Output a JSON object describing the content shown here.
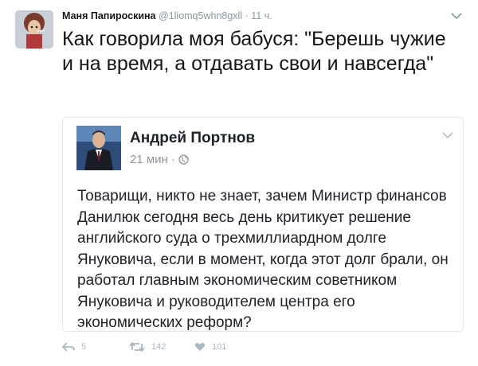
{
  "tweet": {
    "author_name": "Маня Папироскина",
    "author_handle": "@1liomq5whn8gxll",
    "separator": "·",
    "time": "11 ч.",
    "text": "Как говорила моя бабуся: \"Берешь чужие и на время, а отдавать свои и навсегда\""
  },
  "quoted_post": {
    "author_name": "Андрей Портнов",
    "time": "21 мин",
    "separator": "·",
    "privacy_icon": "globe-icon",
    "text": "Товарищи, никто не знает, зачем Министр финансов Данилюк сегодня весь день критикует решение английского суда о трехмиллиардном долге Януковича, если в момент, когда этот долг брали, он работал главным экономическим советником Януковича и руководителем центра его экономических реформ?"
  },
  "actions": {
    "reply_count": "5",
    "retweet_count": "142",
    "like_count": "101"
  },
  "colors": {
    "text": "#14171a",
    "muted": "#8899a6",
    "border": "#e1e8ed",
    "action": "#aab8c2"
  }
}
